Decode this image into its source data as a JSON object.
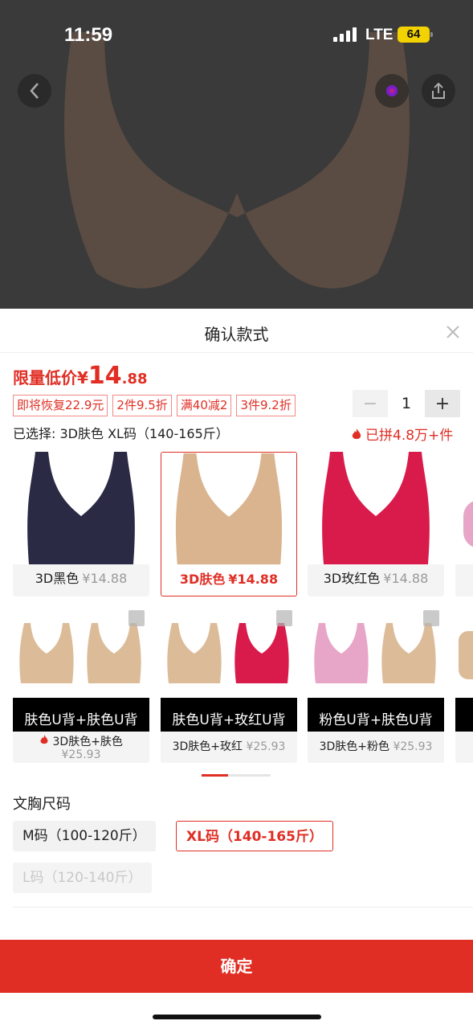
{
  "status_bar": {
    "time": "11:59",
    "network": "LTE",
    "battery": "64"
  },
  "sheet": {
    "title": "确认款式",
    "price": {
      "label": "限量低价",
      "currency": "¥",
      "integer": "14",
      "decimal": ".88"
    },
    "promos": [
      "即将恢复22.9元",
      "2件9.5折",
      "满40减2",
      "3件9.2折"
    ],
    "quantity": "1",
    "selected_text": "已选择: 3D肤色 XL码（140-165斤）",
    "sold_text": "已拼4.8万+件",
    "variants_row1": [
      {
        "name": "3D黑色",
        "price": "¥14.88",
        "color": "#2b2a45"
      },
      {
        "name": "3D肤色",
        "price": "¥14.88",
        "color": "#d9b48e"
      },
      {
        "name": "3D玫红色",
        "price": "¥14.88",
        "color": "#d81b4a"
      }
    ],
    "variants_row2": [
      {
        "banner": "肤色U背+肤色U背",
        "name": "3D肤色+肤色",
        "price": "¥25.93",
        "colors": [
          "#dcbc98",
          "#dcbc98"
        ]
      },
      {
        "banner": "肤色U背+玫红U背",
        "name": "3D肤色+玫红",
        "price": "¥25.93",
        "colors": [
          "#dcbc98",
          "#d81b4a"
        ]
      },
      {
        "banner": "粉色U背+肤色U背",
        "name": "3D肤色+粉色",
        "price": "¥25.93",
        "colors": [
          "#e7a6c7",
          "#dcbc98"
        ]
      }
    ],
    "size_title": "文胸尺码",
    "sizes": {
      "m": "M码（100-120斤）",
      "xl": "XL码（140-165斤）",
      "l": "L码（120-140斤）"
    },
    "confirm": "确定"
  },
  "colors": {
    "accent": "#e02e24"
  }
}
